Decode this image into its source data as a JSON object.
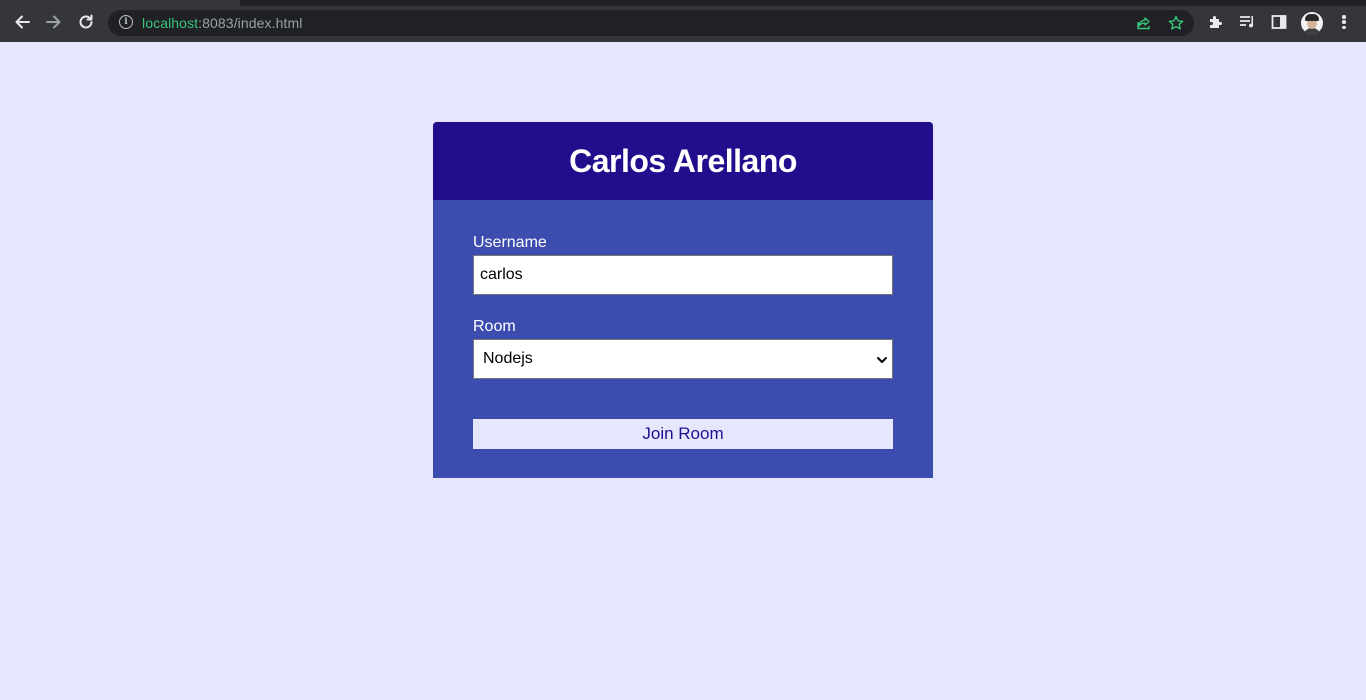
{
  "browser": {
    "url_host": "localhost",
    "url_rest": ":8083/index.html"
  },
  "card": {
    "title": "Carlos Arellano"
  },
  "form": {
    "username_label": "Username",
    "username_value": "carlos",
    "room_label": "Room",
    "room_selected": "Nodejs",
    "join_button_label": "Join Room"
  },
  "colors": {
    "page_background": "#e6e7fd",
    "card_header": "#220e8d",
    "card_body": "#3c4daf",
    "url_host": "#3ac47d"
  }
}
